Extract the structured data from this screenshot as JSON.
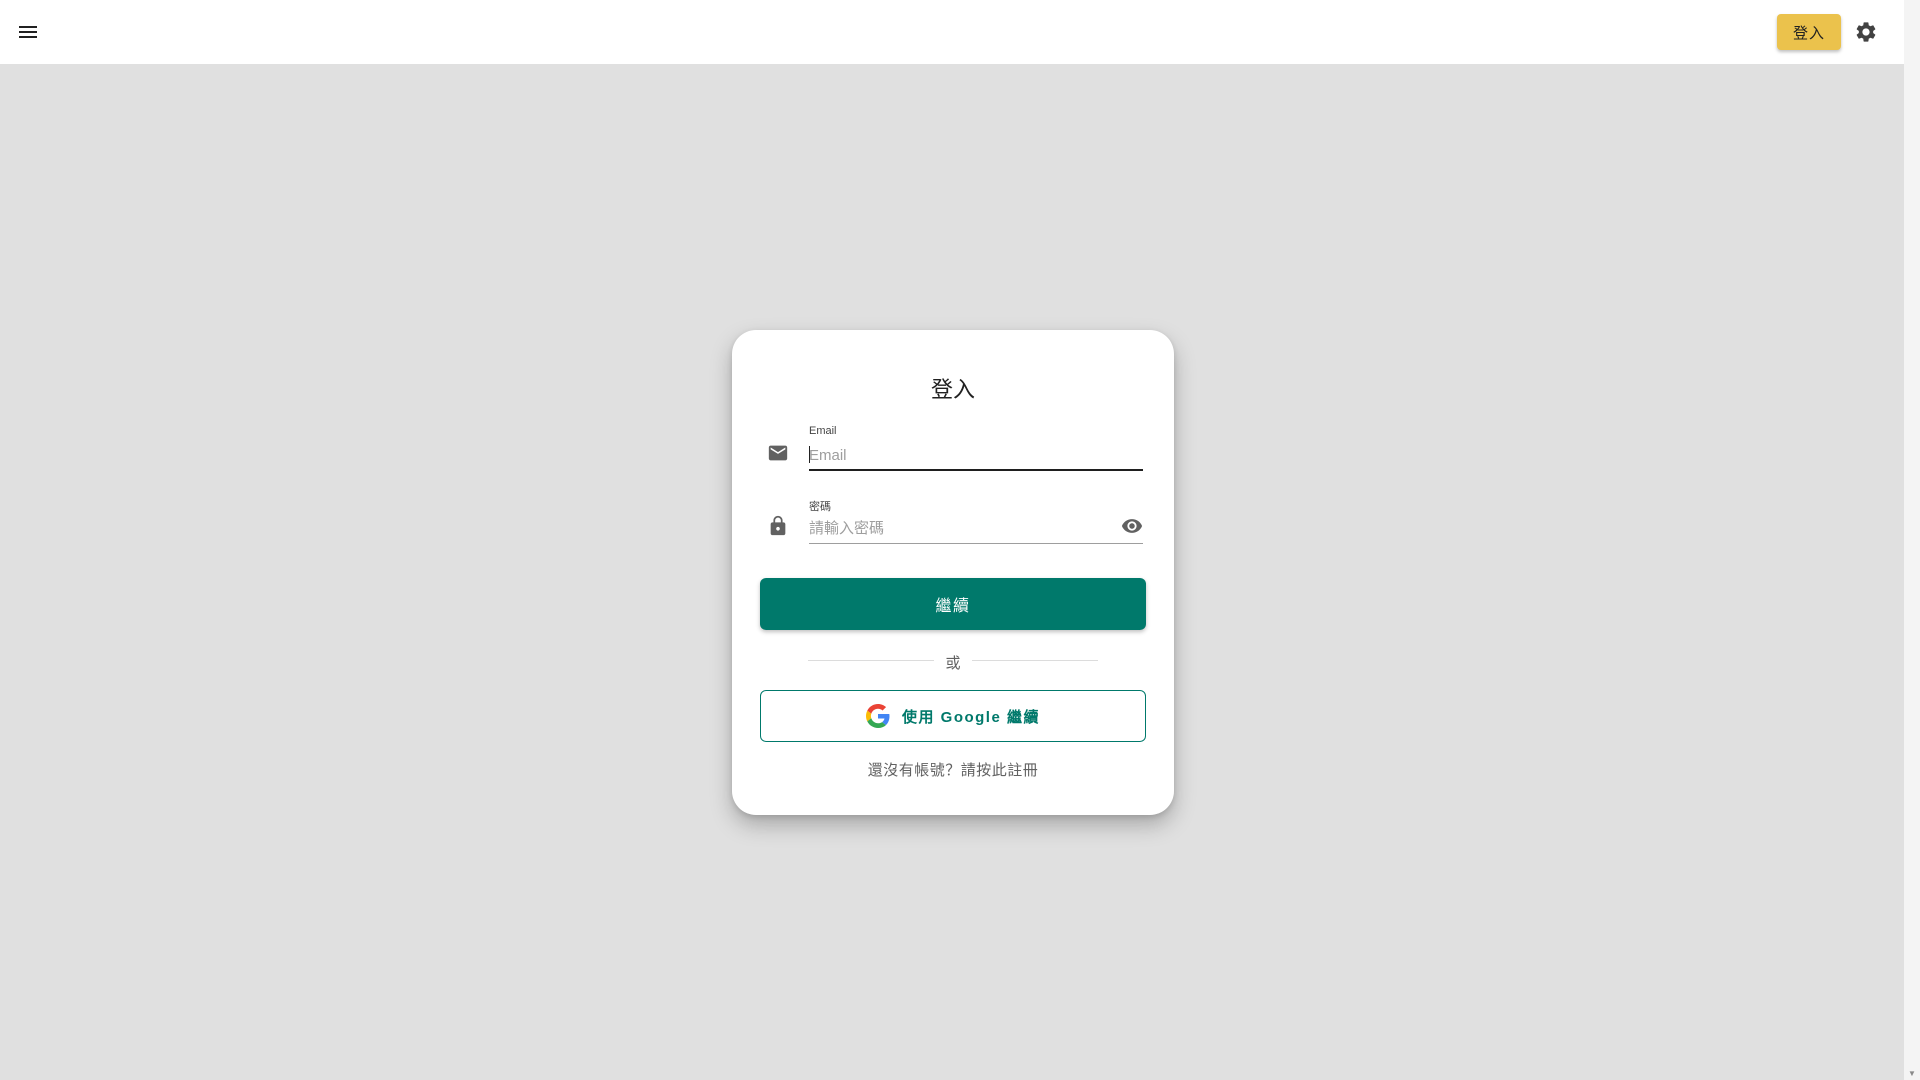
{
  "header": {
    "menu_icon": "menu-icon",
    "login_button_label": "登入",
    "settings_icon": "gear-icon",
    "accent_color": "#ebc24c"
  },
  "login_card": {
    "title": "登入",
    "email": {
      "icon": "mail-icon",
      "label": "Email",
      "value": "",
      "placeholder": "Email"
    },
    "password": {
      "icon": "lock-icon",
      "label": "密碼",
      "value": "",
      "placeholder": "請輸入密碼",
      "toggle_icon": "eye-icon"
    },
    "continue_button_label": "繼續",
    "primary_color": "#00796b",
    "divider_text": "或",
    "google_button": {
      "icon": "google-g-icon",
      "label": "使用 Google 繼續"
    },
    "signup_link": "還沒有帳號？請按此註冊"
  }
}
